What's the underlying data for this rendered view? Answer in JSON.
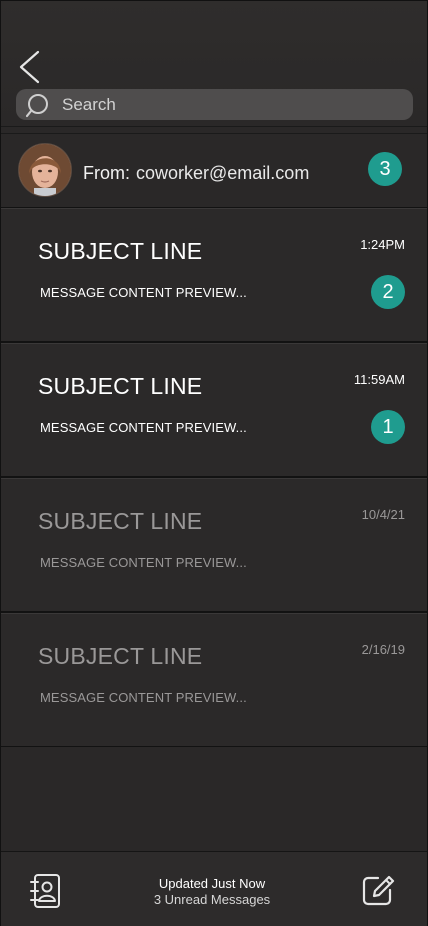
{
  "header": {
    "back_icon": "chevron-left-icon",
    "search": {
      "placeholder": "Search",
      "value": ""
    }
  },
  "sender": {
    "from_label": "From:",
    "address": "coworker@email.com",
    "unread_count": "3"
  },
  "messages": [
    {
      "subject": "SUBJECT LINE",
      "preview": "MESSAGE CONTENT PREVIEW...",
      "time": "1:24PM",
      "badge": "2",
      "unread": true
    },
    {
      "subject": "SUBJECT LINE",
      "preview": "MESSAGE CONTENT PREVIEW...",
      "time": "11:59AM",
      "badge": "1",
      "unread": true
    },
    {
      "subject": "SUBJECT LINE",
      "preview": "MESSAGE CONTENT PREVIEW...",
      "time": "10/4/21",
      "badge": "",
      "unread": false
    },
    {
      "subject": "SUBJECT LINE",
      "preview": "MESSAGE CONTENT PREVIEW...",
      "time": "2/16/19",
      "badge": "",
      "unread": false
    }
  ],
  "footer": {
    "status_line1": "Updated Just Now",
    "status_line2": "3 Unread Messages",
    "left_icon": "contacts-book-icon",
    "right_icon": "compose-icon"
  },
  "colors": {
    "background": "#2a2828",
    "badge": "#1f9c8f",
    "search_bg": "#4f4d4d",
    "read_text": "#9a9898"
  }
}
